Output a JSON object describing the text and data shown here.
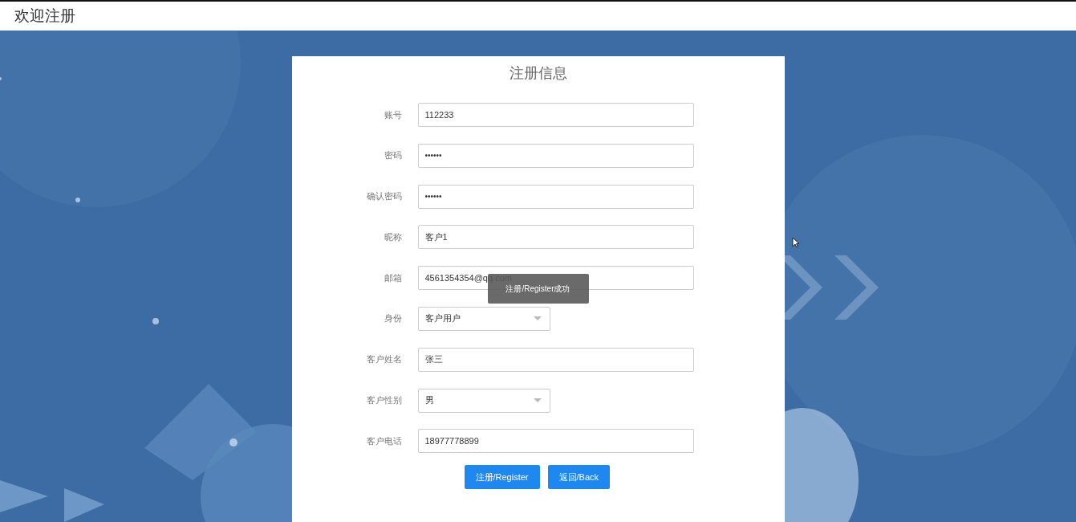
{
  "header": {
    "title": "欢迎注册"
  },
  "form": {
    "title": "注册信息",
    "fields": [
      {
        "label": "账号",
        "kind": "text",
        "value": "112233"
      },
      {
        "label": "密码",
        "kind": "password",
        "value": "••••••"
      },
      {
        "label": "确认密码",
        "kind": "password",
        "value": "••••••"
      },
      {
        "label": "昵称",
        "kind": "text",
        "value": "客户1"
      },
      {
        "label": "邮箱",
        "kind": "text",
        "value": "4561354354@qq.com"
      },
      {
        "label": "身份",
        "kind": "select",
        "value": "客户用户"
      },
      {
        "label": "客户姓名",
        "kind": "text",
        "value": "张三"
      },
      {
        "label": "客户性别",
        "kind": "select",
        "value": "男"
      },
      {
        "label": "客户电话",
        "kind": "text",
        "value": "18977778899"
      }
    ],
    "buttons": [
      "注册/Register",
      "返回/Back"
    ]
  },
  "toast": {
    "text": "注册/Register成功"
  }
}
